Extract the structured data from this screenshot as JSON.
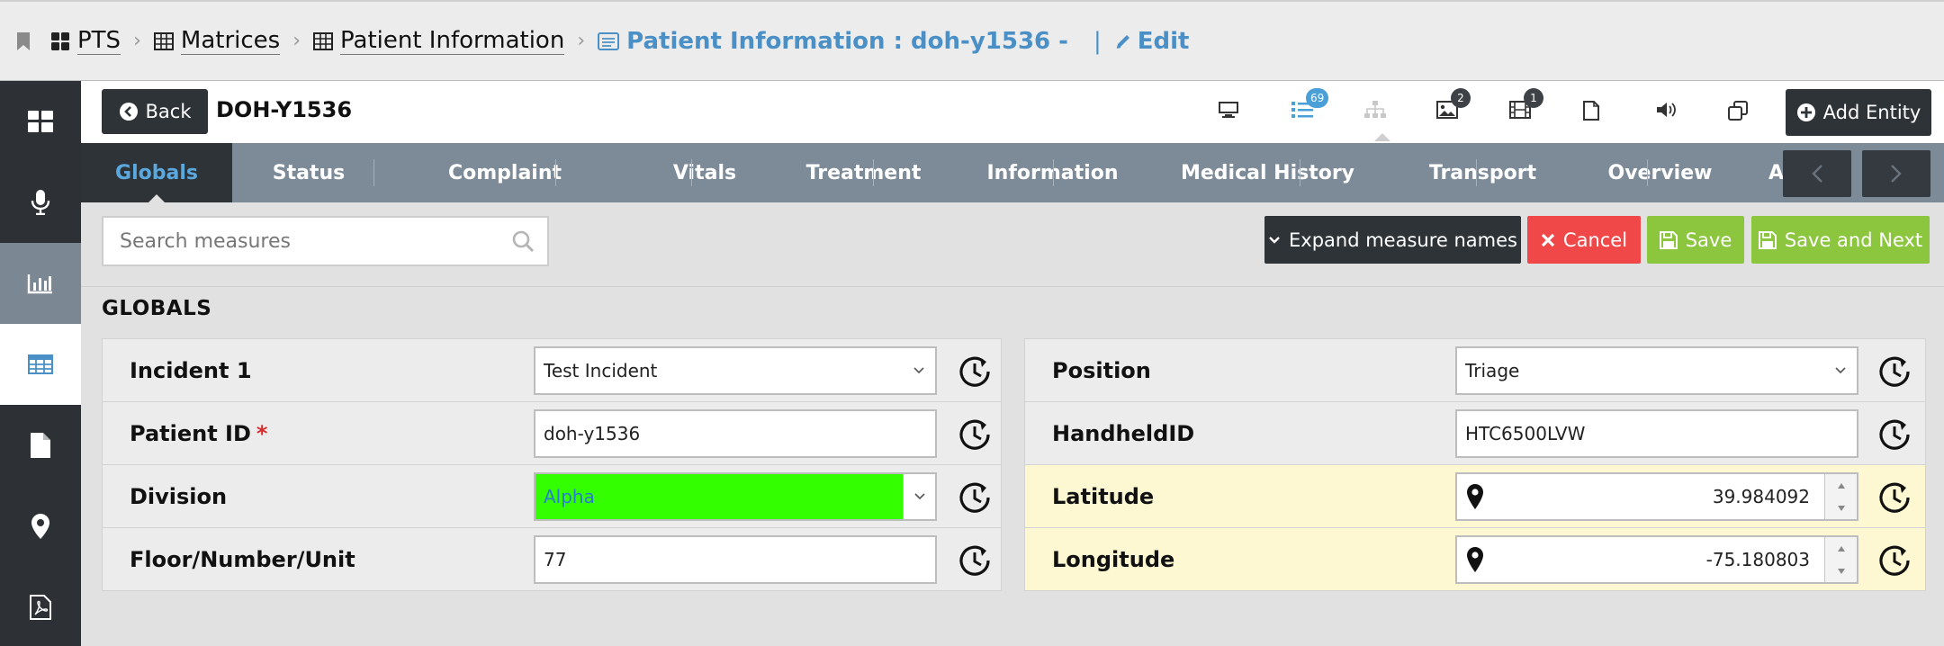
{
  "breadcrumb": {
    "items": [
      {
        "label": "PTS",
        "icon": "grid-icon"
      },
      {
        "label": "Matrices",
        "icon": "table-icon"
      },
      {
        "label": "Patient Information",
        "icon": "table-icon"
      }
    ],
    "current": "Patient Information : doh-y1536  -",
    "edit_label": "Edit",
    "pipe": "|"
  },
  "sidebar": {
    "items": [
      {
        "name": "dashboard",
        "icon": "dashboard-icon"
      },
      {
        "name": "microphone",
        "icon": "microphone-icon"
      },
      {
        "name": "charts",
        "icon": "bar-chart-icon"
      },
      {
        "name": "matrices",
        "icon": "table-icon"
      },
      {
        "name": "documents",
        "icon": "document-icon"
      },
      {
        "name": "locations",
        "icon": "map-pin-icon"
      },
      {
        "name": "pdf",
        "icon": "pdf-icon"
      }
    ]
  },
  "header": {
    "back_label": "Back",
    "entity_id": "DOH-Y1536",
    "add_entity_label": "Add Entity",
    "icons": [
      {
        "name": "desktop-icon",
        "badge": ""
      },
      {
        "name": "list-icon",
        "badge": "69"
      },
      {
        "name": "hierarchy-icon",
        "badge": ""
      },
      {
        "name": "image-icon",
        "badge": "2"
      },
      {
        "name": "film-icon",
        "badge": "1"
      },
      {
        "name": "file-icon",
        "badge": ""
      },
      {
        "name": "speaker-icon",
        "badge": ""
      },
      {
        "name": "copy-icon",
        "badge": ""
      }
    ]
  },
  "tabs": [
    "Globals",
    "Status",
    "Complaint",
    "Vitals",
    "Treatment",
    "Information",
    "Medical History",
    "Transport",
    "Overview",
    "All"
  ],
  "active_tab": "Globals",
  "toolbar": {
    "search_placeholder": "Search measures",
    "expand_label": "Expand measure names",
    "cancel_label": "Cancel",
    "save_label": "Save",
    "save_next_label": "Save and Next"
  },
  "section": {
    "title": "GLOBALS"
  },
  "fields_left": [
    {
      "label": "Incident 1",
      "value": "Test Incident",
      "type": "select",
      "required": false
    },
    {
      "label": "Patient ID",
      "value": "doh-y1536",
      "type": "text",
      "required": true
    },
    {
      "label": "Division",
      "value": "Alpha",
      "type": "select-colored",
      "required": false
    },
    {
      "label": "Floor/Number/Unit",
      "value": "77",
      "type": "text",
      "required": false
    }
  ],
  "fields_right": [
    {
      "label": "Position",
      "value": "Triage",
      "type": "select"
    },
    {
      "label": "HandheldID",
      "value": "HTC6500LVW",
      "type": "text"
    },
    {
      "label": "Latitude",
      "value": "39.984092",
      "type": "number"
    },
    {
      "label": "Longitude",
      "value": "-75.180803",
      "type": "number"
    }
  ],
  "required_marker": "*",
  "colors": {
    "accent": "#4a90c6",
    "dark": "#2e3338",
    "cancel": "#f04848",
    "save": "#8cc63f",
    "division_green": "#33ff00",
    "highlight_row": "#fdf8d2"
  }
}
